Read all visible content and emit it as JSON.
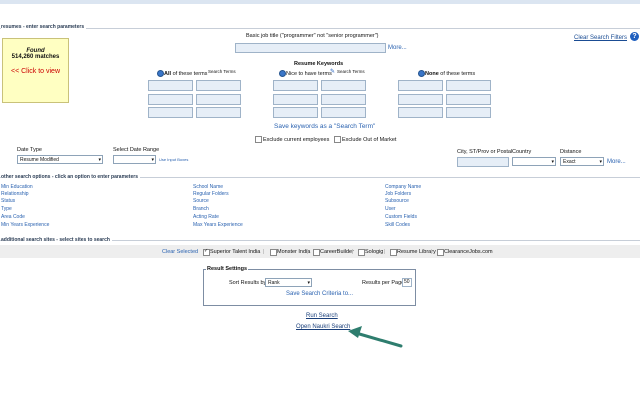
{
  "header": {
    "section_title": "resumes - enter search parameters"
  },
  "found_box": {
    "label": "Found",
    "count": "514,260 matches",
    "view_link": "<< Click to view"
  },
  "job_title": {
    "label": "Basic job title (\"programmer\" not \"senior programmer\")",
    "more_link": "More..."
  },
  "clear_filters": "Clear Search Filters",
  "help_icon": "?",
  "keywords": {
    "title": "Resume Keywords",
    "all_prefix": "All",
    "all_text": "of these terms",
    "all_superscript": "Search Terms",
    "nice_text": "Nice to have terms",
    "nice_superscript": "Search Terms",
    "none_prefix": "None",
    "none_text": "of these terms",
    "save_link": "Save keywords as a \"Search Term\"",
    "exclude_employees": "Exclude current employees",
    "exclude_out_of_market": "Exclude Out of Market"
  },
  "filters": {
    "date_type_label": "Date Type",
    "date_type_value": "Resume Modified",
    "date_range_label": "Select Date Range",
    "input_boxes_link": "Use Input Boxes",
    "city_label": "City, ST/Prov or Postal",
    "country_label": "Country",
    "distance_label": "Distance",
    "distance_value": "Exact",
    "more_link": "More..."
  },
  "other_options": {
    "title": "other search options - click an option to enter parameters",
    "col1": [
      "Min Education",
      "Relationship",
      "Status",
      "Type",
      "Area Code",
      "Min Years Experience"
    ],
    "col2": [
      "School Name",
      "Regular Folders",
      "Source",
      "Branch",
      "Acting Rate",
      "Max Years Experience"
    ],
    "col3": [
      "Company Name",
      "Job Folders",
      "Subsource",
      "User",
      "Custom Fields",
      "Skill Codes"
    ]
  },
  "additional_sites": {
    "title": "additional search sites - select sites to search",
    "clear_link": "Clear Selected",
    "sites": [
      {
        "name": "Superior Talent India",
        "checked": true
      },
      {
        "name": "Monster India",
        "checked": false
      },
      {
        "name": "CareerBuilder",
        "checked": false
      },
      {
        "name": "Sologig",
        "checked": false
      },
      {
        "name": "Resume Library",
        "checked": false
      },
      {
        "name": "ClearanceJobs.com",
        "checked": false
      }
    ]
  },
  "result_settings": {
    "legend": "Result Settings",
    "sort_label": "Sort Results by",
    "sort_value": "Rank",
    "per_page_label": "Results per Page",
    "per_page_value": "50",
    "save_link": "Save Search Criteria to..."
  },
  "actions": {
    "run_search": "Run Search",
    "open_naukri": "Open Naukri Search"
  },
  "colors": {
    "link": "#2a62b0",
    "found_bg": "#ffffc2",
    "arrow": "#2e7d6e",
    "accent_blue": "#1f5fbf"
  }
}
